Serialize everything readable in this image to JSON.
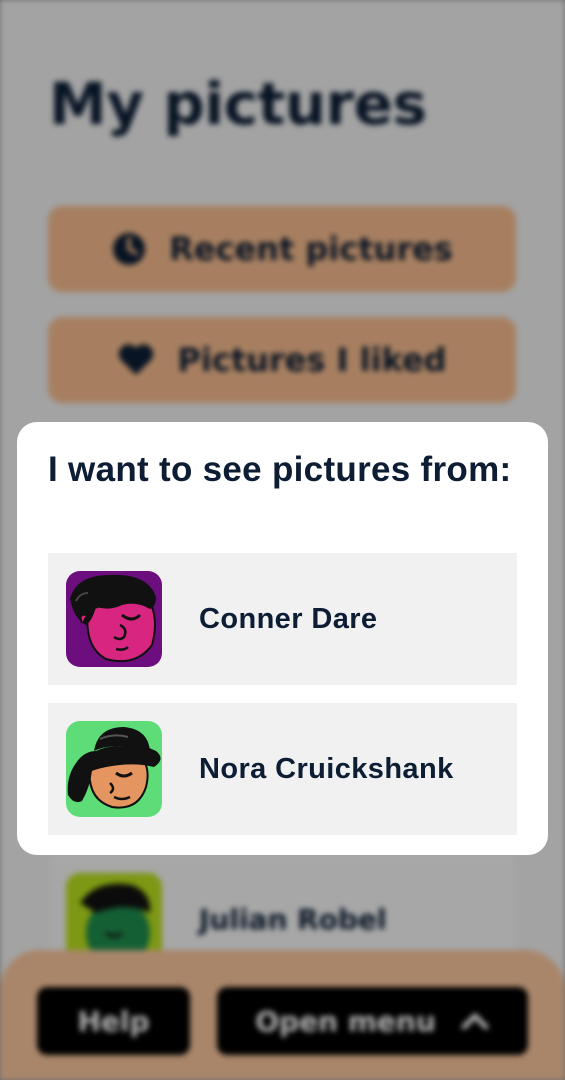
{
  "background": {
    "title": "My pictures",
    "buttons": [
      {
        "label": "Recent pictures",
        "icon": "clock-icon"
      },
      {
        "label": "Pictures I liked",
        "icon": "heart-icon"
      }
    ],
    "hidden_person": {
      "name": "Julian Robel",
      "avatar_color": "#b6dd1c"
    },
    "menu": {
      "help_label": "Help",
      "open_menu_label": "Open menu",
      "open_menu_icon": "chevron-up-icon"
    }
  },
  "modal": {
    "title": "I want to see pictures from:",
    "people": [
      {
        "name": "Conner Dare",
        "avatar_color": "#6d0e7e",
        "skin_color": "#d8257f"
      },
      {
        "name": "Nora Cruickshank",
        "avatar_color": "#5ddc78",
        "skin_color": "#e59560"
      }
    ]
  },
  "colors": {
    "accent": "#f2b98c",
    "text": "#0c1d34",
    "card": "#f1f1f2"
  }
}
